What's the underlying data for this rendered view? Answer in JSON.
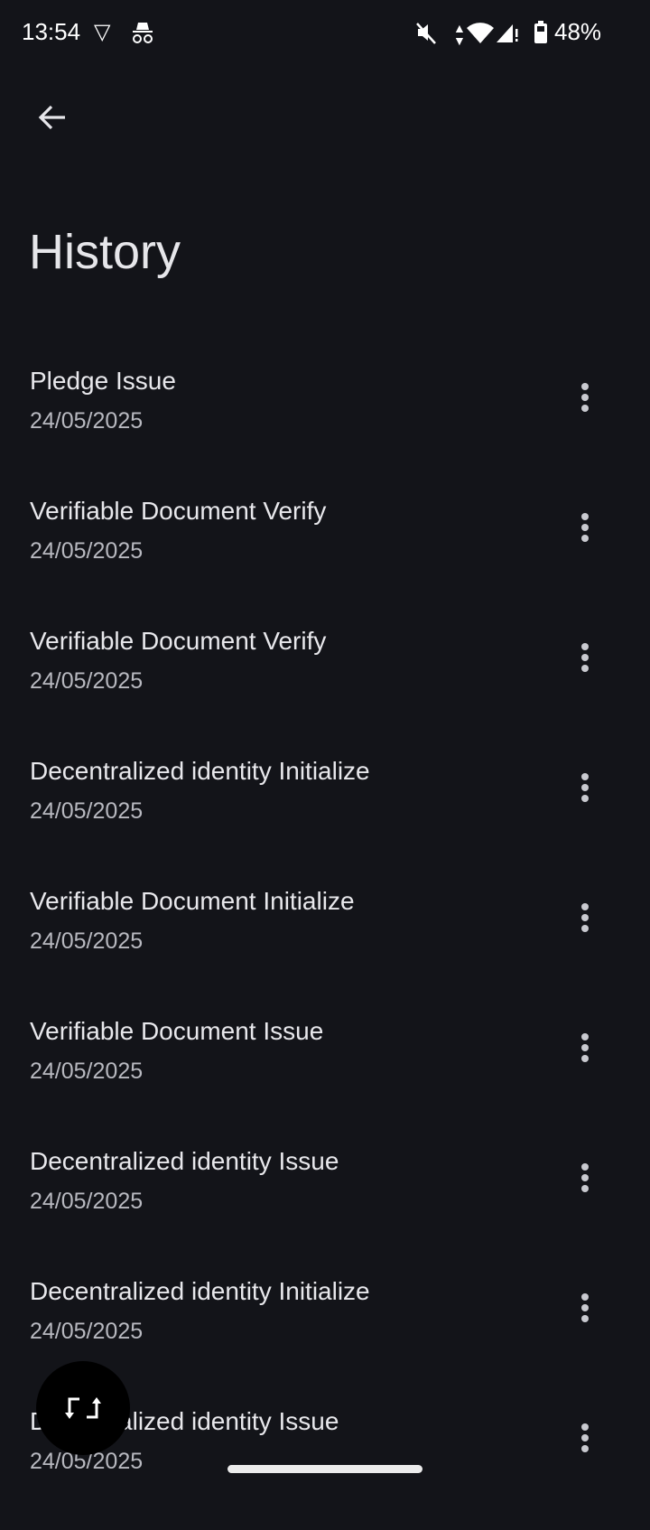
{
  "status_bar": {
    "time": "13:54",
    "battery": "48%"
  },
  "header": {
    "title": "History"
  },
  "items": [
    {
      "title": "Pledge Issue",
      "date": "24/05/2025"
    },
    {
      "title": "Verifiable Document Verify",
      "date": "24/05/2025"
    },
    {
      "title": "Verifiable Document Verify",
      "date": "24/05/2025"
    },
    {
      "title": "Decentralized identity Initialize",
      "date": "24/05/2025"
    },
    {
      "title": "Verifiable Document Initialize",
      "date": "24/05/2025"
    },
    {
      "title": "Verifiable Document Issue",
      "date": "24/05/2025"
    },
    {
      "title": "Decentralized identity Issue",
      "date": "24/05/2025"
    },
    {
      "title": "Decentralized identity Initialize",
      "date": "24/05/2025"
    },
    {
      "title": "Decentralized identity Issue",
      "date": "24/05/2025"
    }
  ]
}
